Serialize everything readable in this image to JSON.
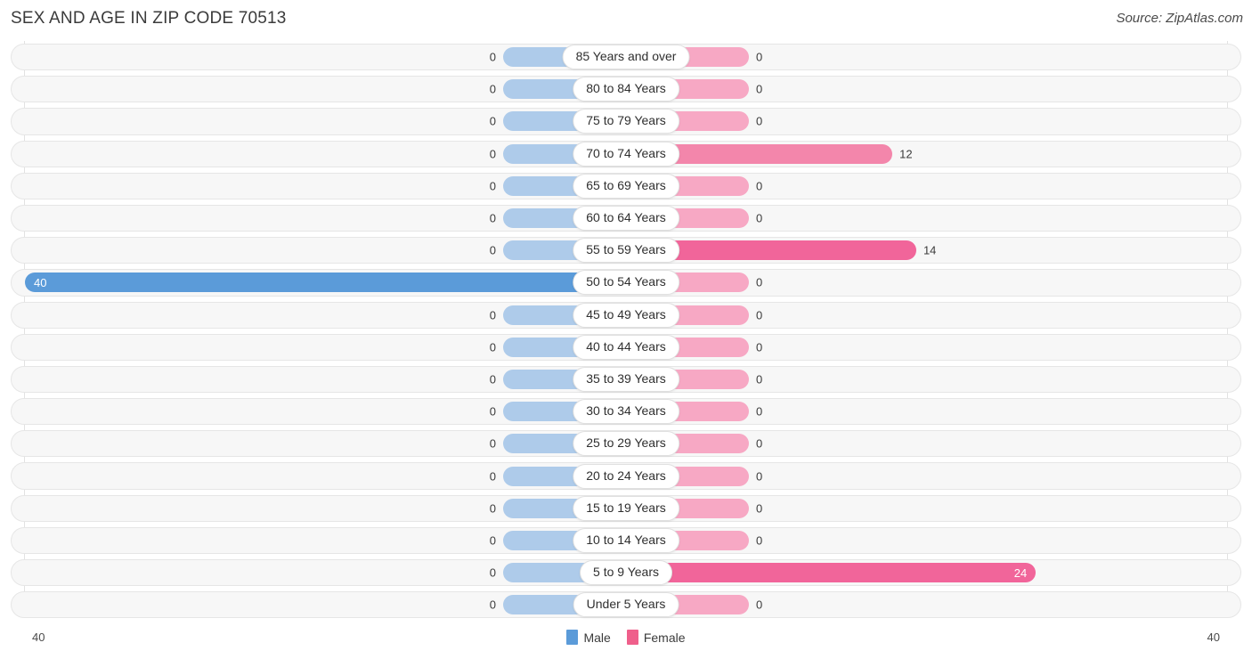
{
  "header": {
    "title": "SEX AND AGE IN ZIP CODE 70513",
    "source": "Source: ZipAtlas.com"
  },
  "footer": {
    "axis_left": "40",
    "axis_right": "40",
    "legend": [
      {
        "label": "Male",
        "color": "#5b9bd9"
      },
      {
        "label": "Female",
        "color": "#ef5f8b"
      }
    ]
  },
  "colors": {
    "male_zero": "#aecbea",
    "male_full": "#5b9bd9",
    "female_zero": "#f7a8c4",
    "female_mid": "#f386ab",
    "female_high": "#f1659a",
    "track": "#f7f7f7",
    "track_border": "#e6e6e6",
    "gridline": "#e2e2e2",
    "text": "#3b3b3b"
  },
  "chart_data": {
    "type": "bar",
    "title": "SEX AND AGE IN ZIP CODE 70513",
    "subtitle": "Source: ZipAtlas.com",
    "orientation": "horizontal-diverging",
    "xlabel": "",
    "ylabel": "",
    "axis_max": 40,
    "xlim": [
      -40,
      40
    ],
    "grid": false,
    "legend_position": "bottom-center",
    "categories": [
      "85 Years and over",
      "80 to 84 Years",
      "75 to 79 Years",
      "70 to 74 Years",
      "65 to 69 Years",
      "60 to 64 Years",
      "55 to 59 Years",
      "50 to 54 Years",
      "45 to 49 Years",
      "40 to 44 Years",
      "35 to 39 Years",
      "30 to 34 Years",
      "25 to 29 Years",
      "20 to 24 Years",
      "15 to 19 Years",
      "10 to 14 Years",
      "5 to 9 Years",
      "Under 5 Years"
    ],
    "series": [
      {
        "name": "Male",
        "color": "#5b9bd9",
        "values": [
          0,
          0,
          0,
          0,
          0,
          0,
          0,
          40,
          0,
          0,
          0,
          0,
          0,
          0,
          0,
          0,
          0,
          0
        ]
      },
      {
        "name": "Female",
        "color": "#ef5f8b",
        "values": [
          0,
          0,
          0,
          12,
          0,
          0,
          14,
          0,
          0,
          0,
          0,
          0,
          0,
          0,
          0,
          0,
          24,
          0
        ]
      }
    ]
  }
}
